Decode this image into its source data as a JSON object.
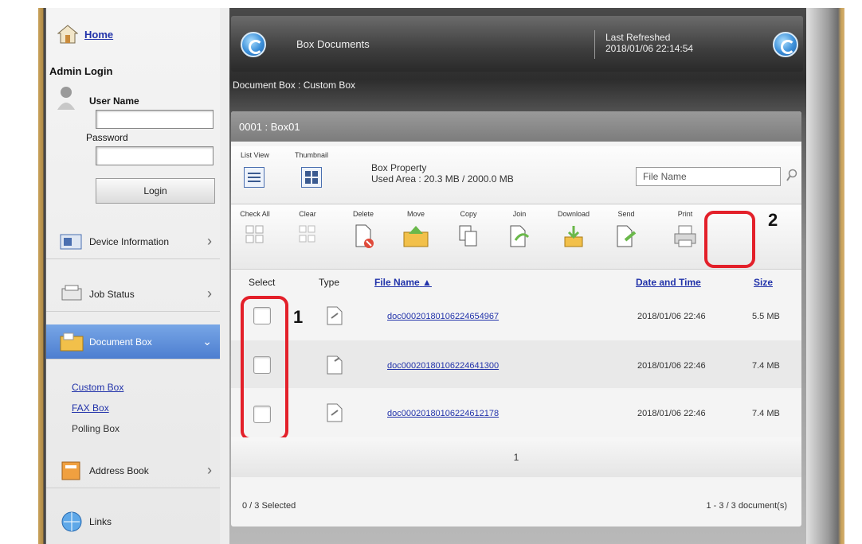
{
  "sidebar": {
    "home": "Home",
    "admin_title": "Admin Login",
    "user_name_label": "User Name",
    "password_label": "Password",
    "login_button": "Login",
    "items": [
      {
        "label": "Device Information"
      },
      {
        "label": "Job Status"
      },
      {
        "label": "Document Box"
      },
      {
        "label": "Address Book"
      },
      {
        "label": "Links"
      }
    ],
    "sub_items": [
      "Custom Box",
      "FAX Box",
      "Polling Box"
    ]
  },
  "header": {
    "title": "Box Documents",
    "user_line1": "Last Refreshed",
    "user_line2": "2018/01/06 22:14:54",
    "breadcrumb": "Document Box : Custom Box"
  },
  "panel": {
    "title": "0001 : Box01",
    "list_view_label": "List View",
    "thumbnail_label": "Thumbnail",
    "box_property": "Box Property",
    "used_area": "Used Area : 20.3 MB / 2000.0 MB",
    "file_name_placeholder": "File Name"
  },
  "toolbar": {
    "tools": [
      "Check All",
      "Clear",
      "Delete",
      "Move",
      "Copy",
      "Join",
      "Download",
      "Send",
      "Print"
    ]
  },
  "table": {
    "headers": {
      "select": "Select",
      "type": "Type",
      "file_name": "File Name",
      "sort_indicator": "▲",
      "date": "Date and Time",
      "size": "Size"
    },
    "rows": [
      {
        "file": "doc00020180106224654967",
        "date": "2018/01/06 22:46",
        "size": "5.5 MB"
      },
      {
        "file": "doc00020180106224641300",
        "date": "2018/01/06 22:46",
        "size": "7.4 MB"
      },
      {
        "file": "doc00020180106224612178",
        "date": "2018/01/06 22:46",
        "size": "7.4 MB"
      }
    ]
  },
  "pager": {
    "page": "1"
  },
  "footer": {
    "selected": "0 / 3 Selected",
    "count": "1 - 3 / 3 document(s)"
  },
  "callouts": {
    "one": "1",
    "two": "2"
  },
  "colors": {
    "highlight": "#e3202a",
    "active_nav": "#5a8ad8",
    "link": "#2233aa"
  }
}
